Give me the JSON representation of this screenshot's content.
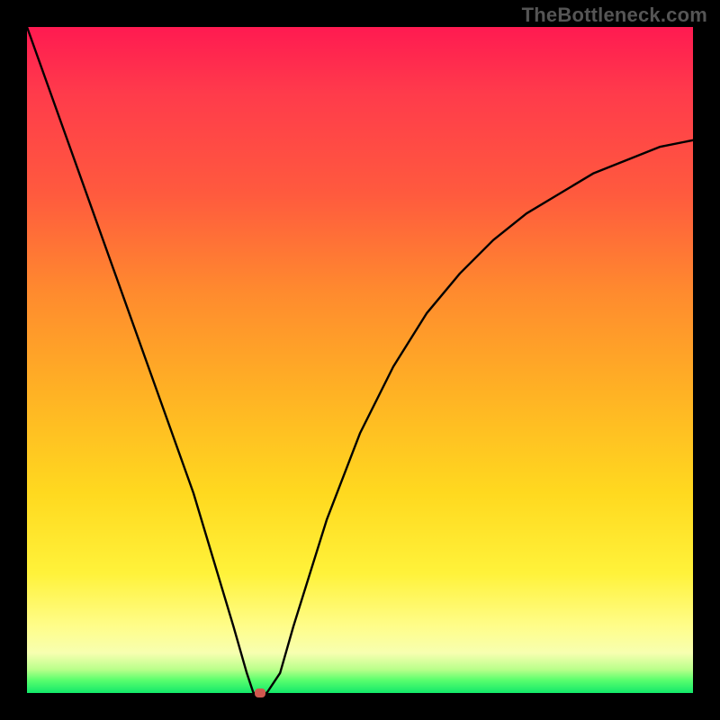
{
  "watermark": "TheBottleneck.com",
  "chart_data": {
    "type": "line",
    "title": "",
    "xlabel": "",
    "ylabel": "",
    "xlim": [
      0,
      100
    ],
    "ylim": [
      0,
      100
    ],
    "series": [
      {
        "name": "curve",
        "x": [
          0,
          5,
          10,
          15,
          20,
          25,
          28,
          31,
          33,
          34,
          35,
          36,
          38,
          40,
          45,
          50,
          55,
          60,
          65,
          70,
          75,
          80,
          85,
          90,
          95,
          100
        ],
        "y": [
          100,
          86,
          72,
          58,
          44,
          30,
          20,
          10,
          3,
          0,
          0,
          0,
          3,
          10,
          26,
          39,
          49,
          57,
          63,
          68,
          72,
          75,
          78,
          80,
          82,
          83
        ]
      }
    ],
    "annotations": [
      {
        "name": "min-marker",
        "x": 35,
        "y": 0
      }
    ],
    "background_gradient": {
      "top": "#ff1a51",
      "mid1": "#ff8b2e",
      "mid2": "#ffd91f",
      "bottom": "#12e86a"
    }
  }
}
